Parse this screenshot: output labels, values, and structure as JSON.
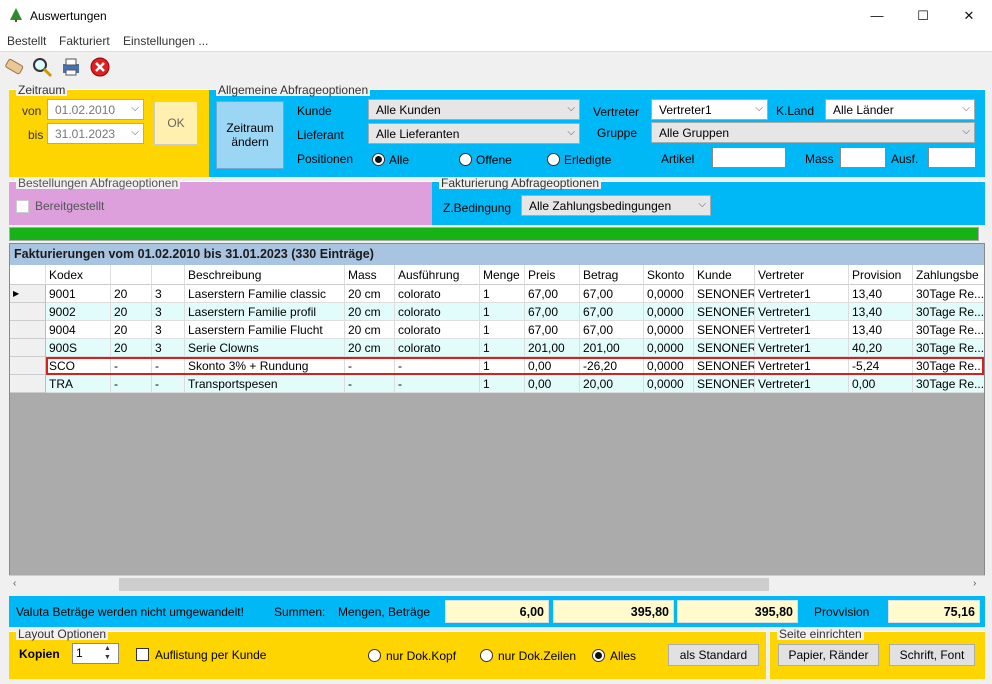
{
  "window": {
    "title": "Auswertungen",
    "min": "—",
    "max": "☐",
    "close": "✕"
  },
  "menu": [
    "Bestellt",
    "Fakturiert",
    "Einstellungen ..."
  ],
  "zeitraum": {
    "title": "Zeitraum",
    "von_label": "von",
    "von": "01.02.2010",
    "bis_label": "bis",
    "bis": "31.01.2023",
    "ok": "OK"
  },
  "allgemein": {
    "title": "Allgemeine Abfrageoptionen",
    "zeitraum_btn": "Zeitraum ändern",
    "kunde_label": "Kunde",
    "kunde": "Alle Kunden",
    "lieferant_label": "Lieferant",
    "lieferant": "Alle Lieferanten",
    "positionen_label": "Positionen",
    "radio_alle": "Alle",
    "radio_offene": "Offene",
    "radio_erledigte": "Erledigte",
    "vertreter_label": "Vertreter",
    "vertreter": "Vertreter1",
    "kland_label": "K.Land",
    "kland": "Alle Länder",
    "gruppe_label": "Gruppe",
    "gruppe": "Alle Gruppen",
    "artikel_label": "Artikel",
    "mass_label": "Mass",
    "ausf_label": "Ausf."
  },
  "bestellungen": {
    "title": "Bestellungen Abfrageoptionen",
    "bereitgestellt": "Bereitgestellt"
  },
  "fakturierung": {
    "title": "Fakturierung Abfrageoptionen",
    "zbed_label": "Z.Bedingung",
    "zbed": "Alle Zahlungsbedingungen"
  },
  "grid": {
    "heading": "Fakturierungen vom 01.02.2010 bis 31.01.2023 (330 Einträge)",
    "columns": [
      "Kodex",
      "",
      "",
      "Beschreibung",
      "Mass",
      "Ausführung",
      "Menge",
      "Preis",
      "Betrag",
      "Skonto",
      "Kunde",
      "Vertreter",
      "Provision",
      "Zahlungsbe"
    ],
    "rows": [
      [
        "9001",
        "20",
        "3",
        "Laserstern Familie classic",
        "20 cm",
        "colorato",
        "1",
        "67,00",
        "67,00",
        "0,0000",
        "SENONER",
        "Vertreter1",
        "13,40",
        "30Tage Re..."
      ],
      [
        "9002",
        "20",
        "3",
        "Laserstern Familie profil",
        "20 cm",
        "colorato",
        "1",
        "67,00",
        "67,00",
        "0,0000",
        "SENONER",
        "Vertreter1",
        "13,40",
        "30Tage Re..."
      ],
      [
        "9004",
        "20",
        "3",
        "Laserstern Familie Flucht",
        "20 cm",
        "colorato",
        "1",
        "67,00",
        "67,00",
        "0,0000",
        "SENONER",
        "Vertreter1",
        "13,40",
        "30Tage Re..."
      ],
      [
        "900S",
        "20",
        "3",
        "Serie Clowns",
        "20 cm",
        "colorato",
        "1",
        "201,00",
        "201,00",
        "0,0000",
        "SENONER",
        "Vertreter1",
        "40,20",
        "30Tage Re..."
      ],
      [
        "SCO",
        "-",
        "-",
        "Skonto 3% + Rundung",
        "-",
        "-",
        "1",
        "0,00",
        "-26,20",
        "0,0000",
        "SENONER",
        "Vertreter1",
        "-5,24",
        "30Tage Re..."
      ],
      [
        "TRA",
        "-",
        "-",
        "Transportspesen",
        "-",
        "-",
        "1",
        "0,00",
        "20,00",
        "0,0000",
        "SENONER",
        "Vertreter1",
        "0,00",
        "30Tage Re..."
      ]
    ]
  },
  "summary": {
    "note": "Valuta Beträge werden nicht umgewandelt!",
    "summen": "Summen:",
    "mengen": "Mengen, Beträge",
    "menge": "6,00",
    "betrag1": "395,80",
    "betrag2": "395,80",
    "provision_label": "Provvision",
    "provision": "75,16"
  },
  "layout": {
    "title": "Layout Optionen",
    "kopien_label": "Kopien",
    "kopien": "1",
    "auflistung": "Auflistung per Kunde",
    "r1": "nur Dok.Kopf",
    "r2": "nur Dok.Zeilen",
    "r3": "Alles",
    "standard": "als Standard"
  },
  "seite": {
    "title": "Seite einrichten",
    "papier": "Papier, Ränder",
    "schrift": "Schrift, Font"
  }
}
